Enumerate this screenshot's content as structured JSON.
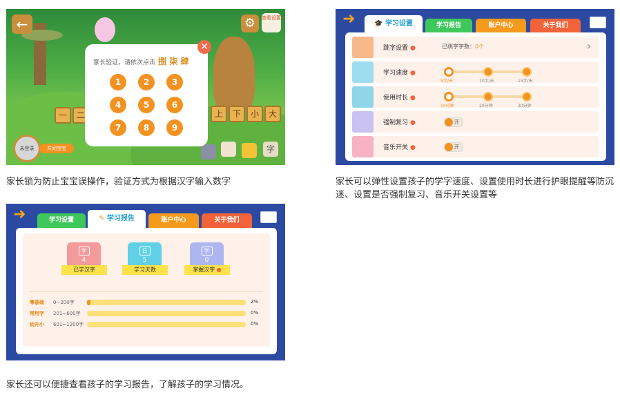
{
  "panel1": {
    "lock_prompt": "家长验证，请依次点击",
    "lock_chars": "捌 柒 肆",
    "numbers": [
      "1",
      "2",
      "3",
      "4",
      "5",
      "6",
      "7",
      "8",
      "9"
    ],
    "top_right_label": "查看设置",
    "avatar_label": "未登录",
    "avatar_button": "共同宝宝",
    "tiles": [
      "一",
      "二",
      "上",
      "下",
      "小",
      "大"
    ],
    "bottom_tile": "字"
  },
  "caption1": "家长锁为防止宝宝误操作，验证方式为根据汉字输入数字",
  "caption2": "家长可以弹性设置孩子的学字速度、设置使用时长进行护眼提醒等防沉迷、设置是否强制复习、音乐开关设置等",
  "caption3": "家长还可以便捷查看孩子的学习报告，了解孩子的学习情况。",
  "tabs": [
    "学习设置",
    "学习报告",
    "账户中心",
    "关于我们"
  ],
  "settings": {
    "rows": [
      {
        "label": "跳字设置",
        "value_prefix": "已跳字字数：",
        "value": "0个"
      },
      {
        "label": "学习速度",
        "stops": [
          "5字/天",
          "10字/天",
          "15字/天"
        ],
        "selected": 0
      },
      {
        "label": "使用时长",
        "stops": [
          "10分钟",
          "20分钟",
          "30分钟"
        ],
        "selected": 0
      },
      {
        "label": "强制复习",
        "toggle": "开"
      },
      {
        "label": "音乐开关",
        "toggle": "开"
      }
    ]
  },
  "report": {
    "cards": [
      {
        "glyph": "字",
        "value": "4",
        "label": "已学汉字",
        "color": "#f39a9a"
      },
      {
        "glyph": "日",
        "value": "5",
        "label": "学习天数",
        "color": "#5fd0e6"
      },
      {
        "glyph": "字",
        "value": "0",
        "label": "掌握汉字",
        "color": "#aeb6f0"
      }
    ],
    "levels": [
      {
        "name": "零基础",
        "range": "0~200字",
        "percent": "2%",
        "fraction": 0.02
      },
      {
        "name": "常用字",
        "range": "201~600字",
        "percent": "0%",
        "fraction": 0
      },
      {
        "name": "幼升小",
        "range": "601~1200字",
        "percent": "0%",
        "fraction": 0
      }
    ]
  },
  "colors": {
    "frame": "#2d4aa3",
    "accent": "#f39221",
    "green_tab": "#3ec85b",
    "orange_tab": "#f59a1d",
    "red_tab": "#f2633a"
  }
}
